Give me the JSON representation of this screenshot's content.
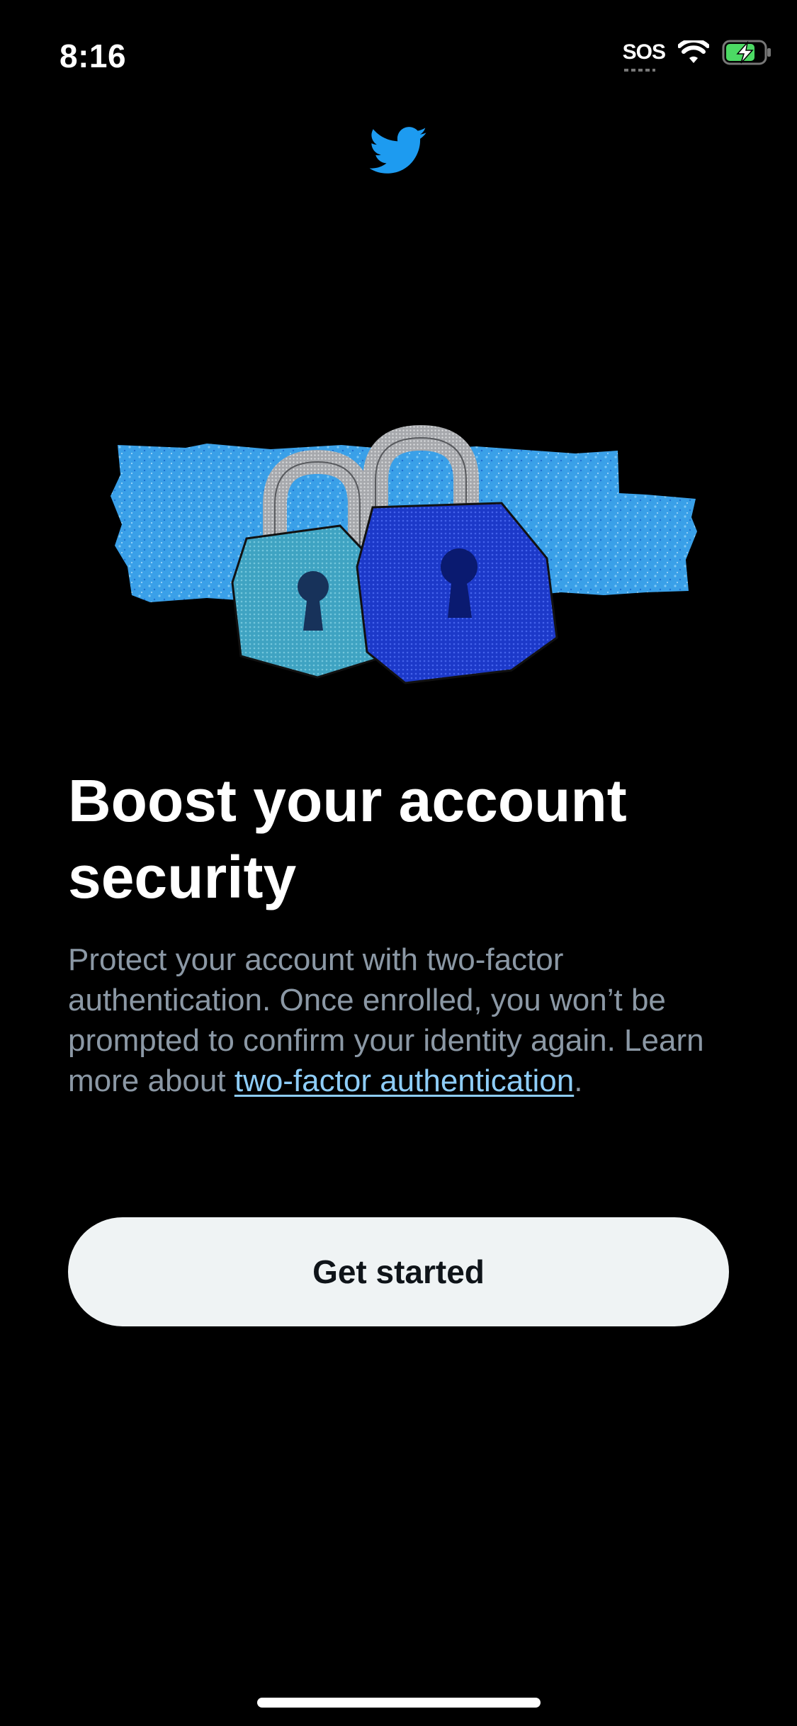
{
  "status_bar": {
    "time": "8:16",
    "sos": "SOS",
    "icons": [
      "wifi-icon",
      "battery-charging-icon"
    ]
  },
  "logo": {
    "icon": "twitter-bird-icon",
    "color": "#1d9bf0"
  },
  "hero": {
    "icon": "padlocks-illustration"
  },
  "headline": "Boost your account security",
  "description": {
    "text": "Protect your account with two-factor authentication. Once enrolled, you won’t be prompted to confirm your identity again. Learn more about ",
    "link_text": "two-factor authentication",
    "suffix": "."
  },
  "cta": {
    "label": "Get started"
  },
  "colors": {
    "background": "#000000",
    "text_primary": "#ffffff",
    "text_secondary": "#8b98a5",
    "link": "#8ecdf8",
    "button_bg": "#eff3f4",
    "button_text": "#0f1419"
  }
}
